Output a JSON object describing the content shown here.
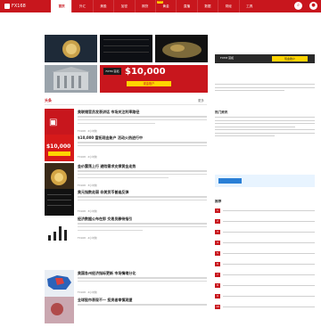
{
  "header": {
    "logo_text": "FX168",
    "nav": [
      {
        "label": "首页"
      },
      {
        "label": "外汇"
      },
      {
        "label": "美股"
      },
      {
        "label": "加密"
      },
      {
        "label": "期货"
      },
      {
        "label": "黄金"
      },
      {
        "label": "直播"
      },
      {
        "label": "数据"
      },
      {
        "label": "财经"
      },
      {
        "label": "工具"
      }
    ],
    "nav_badge": "NEW",
    "icons": [
      "search-icon",
      "user-icon"
    ]
  },
  "featured": {
    "tiles": [
      {
        "caption": ""
      },
      {
        "caption": ""
      },
      {
        "caption": ""
      },
      {
        "caption": ""
      },
      {
        "headline": "$10,000",
        "sub": "FXTM 富拓",
        "badge": "现金账户"
      },
      {
        "caption": ""
      }
    ]
  },
  "section": {
    "title": "头条",
    "more": "更多"
  },
  "articles": [
    {
      "title": "美联储官员发表讲话 市场关注利率路径",
      "meta": "FX168 · 2小时前"
    },
    {
      "title": "$10,000 富拓现金账户 活动火热进行中",
      "meta": "FX168 · 2小时前"
    },
    {
      "title": "金价震荡上行 避险需求支撑黄金走势",
      "meta": "FX168 · 3小时前"
    },
    {
      "title": "美元指数走弱 非美货币普遍反弹",
      "meta": "FX168 · 3小时前"
    },
    {
      "title": "经济数据公布在即 交易员静待指引",
      "meta": "FX168 · 4小时前"
    },
    {
      "title": "美国各州经济指标更新 市场情绪分化",
      "meta": "FX168 · 4小时前"
    },
    {
      "title": "全球股市表现不一 投资者审慎观望",
      "meta": "FX168 · 5小时前"
    }
  ],
  "sidebar": {
    "ads": [
      "FXTM 富拓",
      "现金账户"
    ],
    "section1": "热门资讯",
    "section2": "推荐",
    "ranks": [
      "1",
      "2",
      "3",
      "4",
      "5",
      "6",
      "7",
      "8",
      "9",
      "10"
    ]
  },
  "colors": {
    "brand": "#c8161d"
  }
}
